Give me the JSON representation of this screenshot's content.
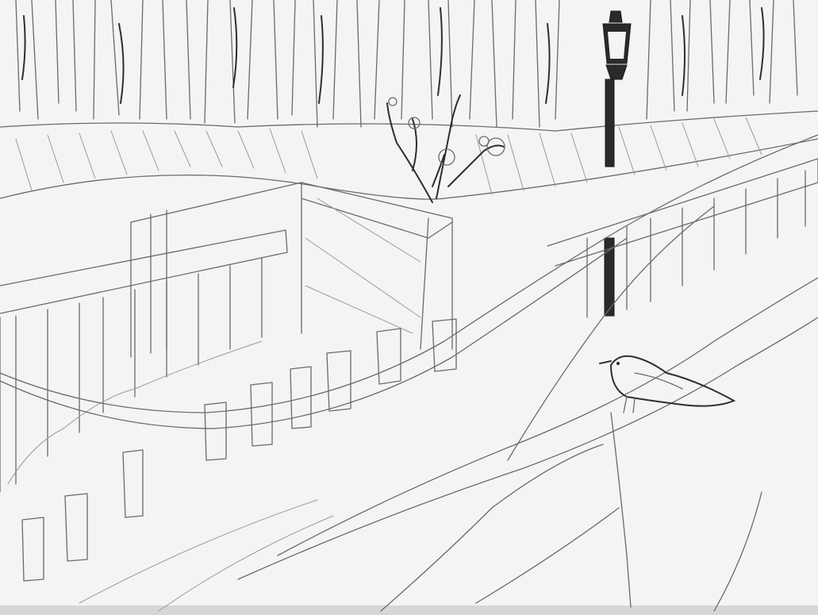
{
  "image": {
    "medium": "pencil-sketch",
    "colors": {
      "paper": "#f4f4f2",
      "graphite": "#6a6a6a",
      "graphite_light": "#9a9a9a",
      "graphite_dark": "#2a2a2a"
    }
  }
}
